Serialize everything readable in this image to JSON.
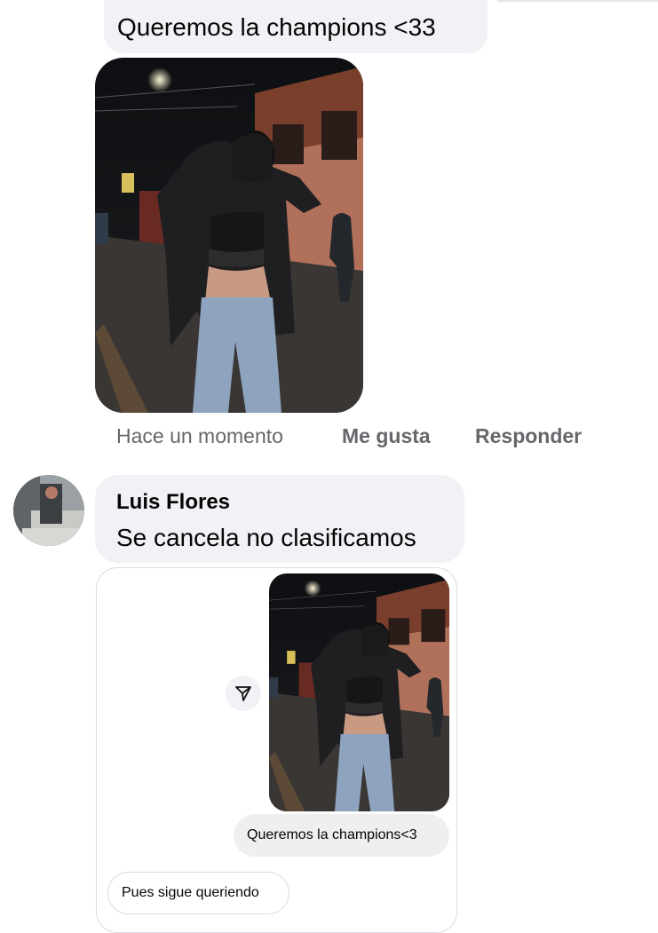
{
  "comment_top": {
    "text": "Queremos la champions <33"
  },
  "comment_actions": {
    "time": "Hace un momento",
    "like": "Me gusta",
    "reply": "Responder"
  },
  "reply_comment": {
    "author": "Luis Flores",
    "text": "Se cancela no clasificamos"
  },
  "dm_preview": {
    "share_icon": "paper-plane-icon",
    "sent_message": "Queremos la champions<3",
    "reply_message": "Pues sigue queriendo"
  },
  "colors": {
    "bubble": "#f0f2f5",
    "meta_text": "#65676b",
    "text": "#050505"
  }
}
